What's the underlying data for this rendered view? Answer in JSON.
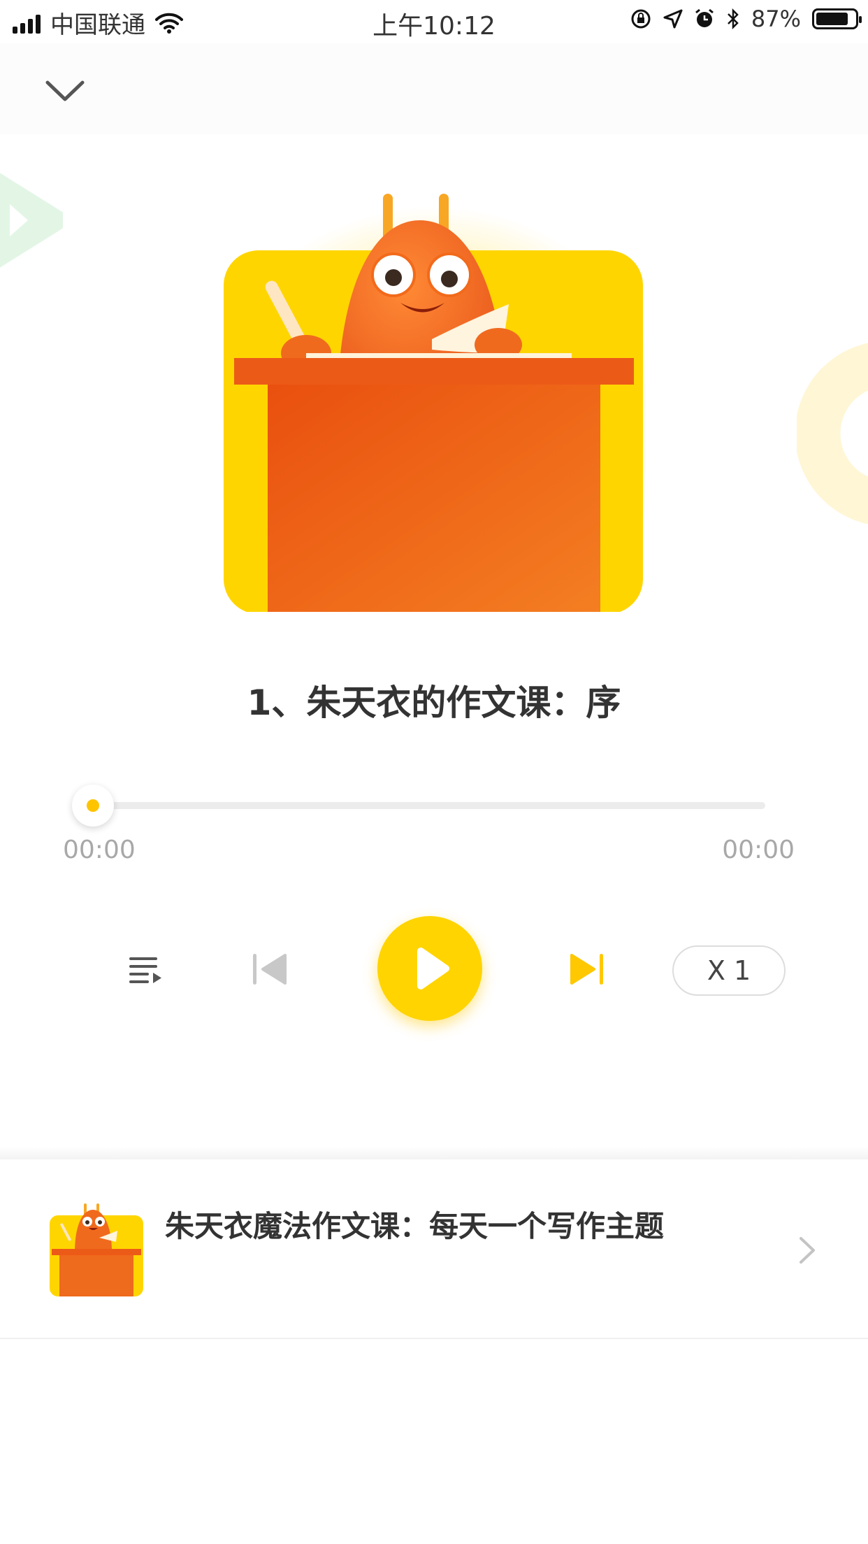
{
  "status_bar": {
    "carrier": "中国联通",
    "time": "上午10:12",
    "battery_percent": "87%",
    "battery_level": 0.87,
    "icons": [
      "signal-icon",
      "wifi-icon",
      "orientation-lock-icon",
      "location-icon",
      "alarm-icon",
      "bluetooth-icon",
      "battery-icon"
    ]
  },
  "header": {
    "collapse_icon": "chevron-down-icon"
  },
  "track": {
    "title": "1、朱天衣的作文课：序",
    "current_time": "00:00",
    "total_time": "00:00",
    "progress": 0
  },
  "controls": {
    "playlist_icon": "playlist-icon",
    "prev_icon": "skip-previous-icon",
    "play_icon": "play-icon",
    "next_icon": "skip-next-icon",
    "speed_label": "X 1"
  },
  "course": {
    "title": "朱天衣魔法作文课：每天一个写作主题",
    "chevron_icon": "chevron-right-icon"
  },
  "colors": {
    "accent": "#FFD400",
    "orange": "#EF5E1A",
    "disabled": "#c8c8c8",
    "text": "#333333",
    "muted": "#a8a8a8"
  }
}
